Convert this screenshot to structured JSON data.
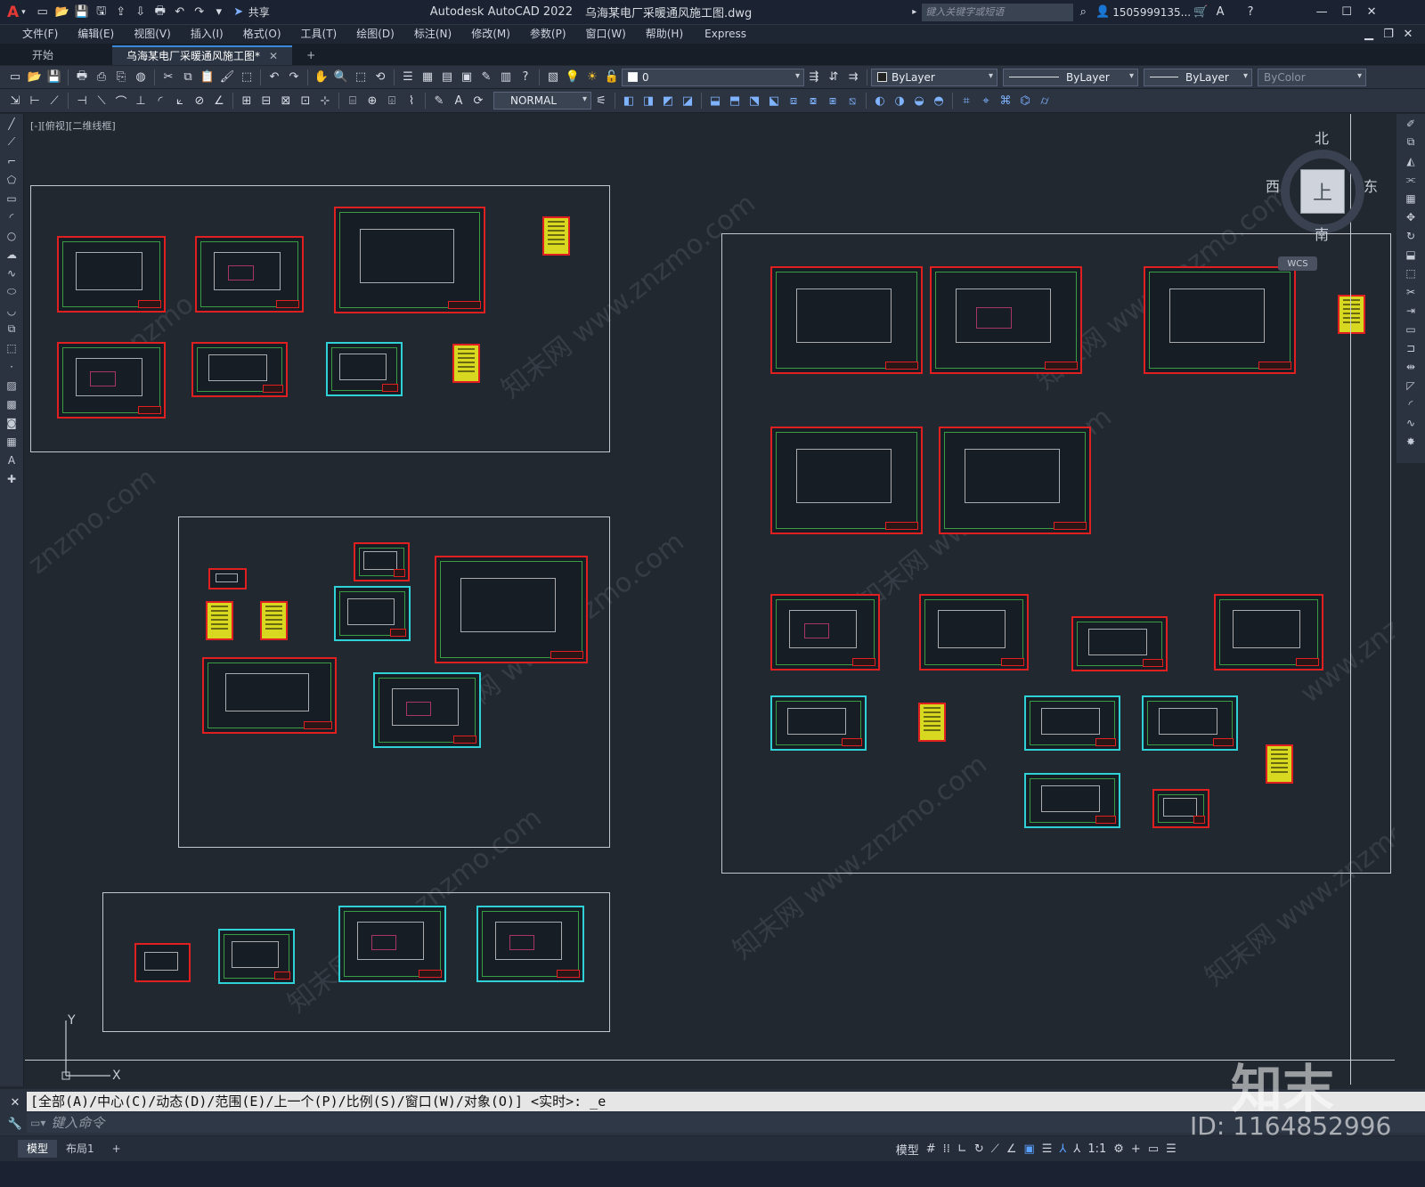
{
  "titlebar": {
    "app_icon": "A",
    "share": "共享",
    "app_title": "Autodesk AutoCAD 2022",
    "file_title": "乌海某电厂采暖通风施工图.dwg",
    "search_placeholder": "键入关键字或短语",
    "user": "1505999135...",
    "window_controls": [
      "minimize",
      "maximize",
      "close"
    ]
  },
  "menu": [
    "文件(F)",
    "编辑(E)",
    "视图(V)",
    "插入(I)",
    "格式(O)",
    "工具(T)",
    "绘图(D)",
    "标注(N)",
    "修改(M)",
    "参数(P)",
    "窗口(W)",
    "帮助(H)",
    "Express"
  ],
  "tabs": {
    "start": "开始",
    "active": "乌海某电厂采暖通风施工图*",
    "add": "+"
  },
  "toolbar": {
    "layer_value": "0",
    "color_value": "ByLayer",
    "linetype_value": "ByLayer",
    "lineweight_value": "ByLayer",
    "plotstyle_value": "ByColor",
    "dimstyle_value": "NORMAL"
  },
  "canvas": {
    "view_label": "[-][俯视][二维线框]",
    "viewcube": {
      "north": "北",
      "south": "南",
      "east": "东",
      "west": "西",
      "top": "上",
      "wcs": "WCS"
    },
    "ucs": {
      "x": "X",
      "y": "Y"
    },
    "watermarks": [
      "知末网 www.znzmo.com",
      "znzmo.com",
      "www.znzmo.com"
    ]
  },
  "command": {
    "history": "[全部(A)/中心(C)/动态(D)/范围(E)/上一个(P)/比例(S)/窗口(W)/对象(O)] <实时>: _e",
    "placeholder": "键入命令"
  },
  "status": {
    "model_tab": "模型",
    "layout_tab": "布局1",
    "add": "+",
    "model_btn": "模型",
    "scale": "1:1"
  },
  "branding": {
    "logo": "知末",
    "id": "ID: 1164852996"
  }
}
